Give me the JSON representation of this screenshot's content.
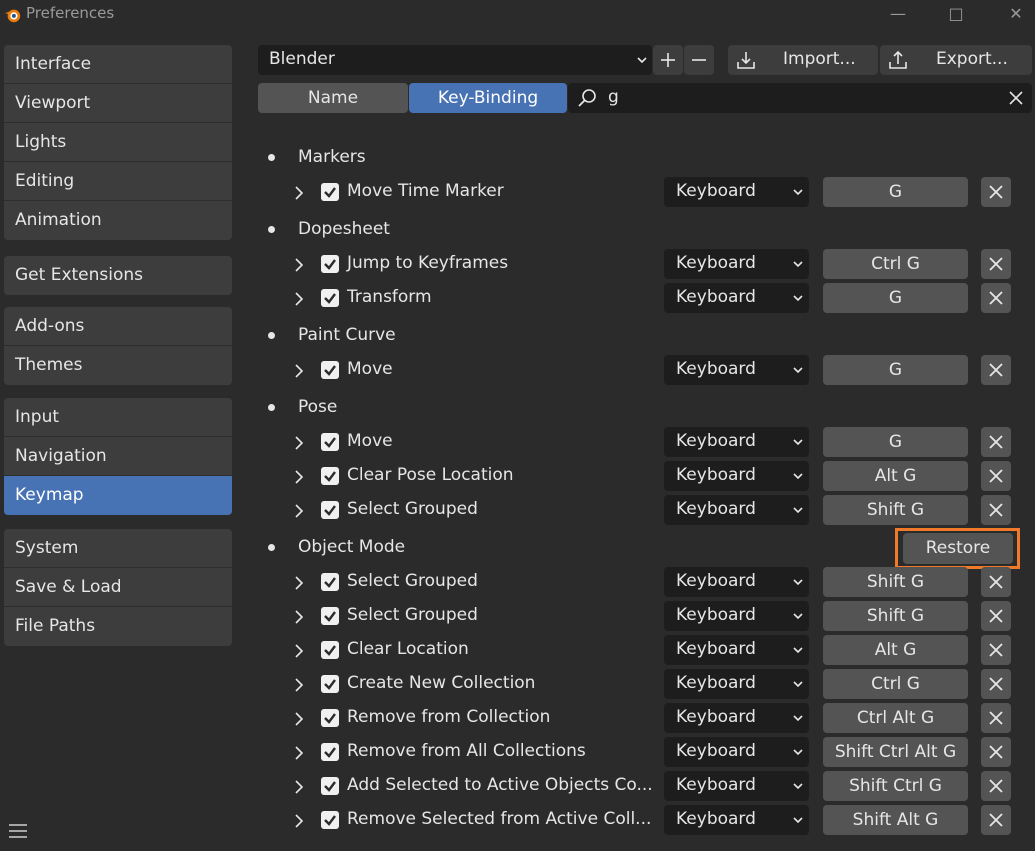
{
  "window": {
    "title": "Preferences"
  },
  "sidebar": {
    "groups": [
      [
        "Interface",
        "Viewport",
        "Lights",
        "Editing",
        "Animation"
      ],
      [
        "Get Extensions"
      ],
      [
        "Add-ons",
        "Themes"
      ],
      [
        "Input",
        "Navigation",
        "Keymap"
      ],
      [
        "System",
        "Save & Load",
        "File Paths"
      ]
    ],
    "active": "Keymap"
  },
  "toolbar": {
    "preset": "Blender",
    "import_label": "Import...",
    "export_label": "Export..."
  },
  "filter": {
    "tabs": [
      "Name",
      "Key-Binding"
    ],
    "active_tab": "Key-Binding",
    "search_value": "g"
  },
  "keymap": {
    "categories": [
      {
        "name": "Markers",
        "items": [
          {
            "label": "Move Time Marker",
            "type": "Keyboard",
            "key": "G"
          }
        ]
      },
      {
        "name": "Dopesheet",
        "items": [
          {
            "label": "Jump to Keyframes",
            "type": "Keyboard",
            "key": "Ctrl G"
          },
          {
            "label": "Transform",
            "type": "Keyboard",
            "key": "G"
          }
        ]
      },
      {
        "name": "Paint Curve",
        "items": [
          {
            "label": "Move",
            "type": "Keyboard",
            "key": "G"
          }
        ]
      },
      {
        "name": "Pose",
        "items": [
          {
            "label": "Move",
            "type": "Keyboard",
            "key": "G"
          },
          {
            "label": "Clear Pose Location",
            "type": "Keyboard",
            "key": "Alt G"
          },
          {
            "label": "Select Grouped",
            "type": "Keyboard",
            "key": "Shift G"
          }
        ]
      },
      {
        "name": "Object Mode",
        "restore_label": "Restore",
        "items": [
          {
            "label": "Select Grouped",
            "type": "Keyboard",
            "key": "Shift G"
          },
          {
            "label": "Select Grouped",
            "type": "Keyboard",
            "key": "Shift G"
          },
          {
            "label": "Clear Location",
            "type": "Keyboard",
            "key": "Alt G"
          },
          {
            "label": "Create New Collection",
            "type": "Keyboard",
            "key": "Ctrl G"
          },
          {
            "label": "Remove from Collection",
            "type": "Keyboard",
            "key": "Ctrl Alt G"
          },
          {
            "label": "Remove from All Collections",
            "type": "Keyboard",
            "key": "Shift Ctrl Alt G"
          },
          {
            "label": "Add Selected to Active Objects Co...",
            "type": "Keyboard",
            "key": "Shift Ctrl G"
          },
          {
            "label": "Remove Selected from Active Coll...",
            "type": "Keyboard",
            "key": "Shift Alt G"
          }
        ]
      }
    ]
  },
  "colors": {
    "accent": "#4772b3",
    "highlight_outline": "#f07a2a"
  }
}
